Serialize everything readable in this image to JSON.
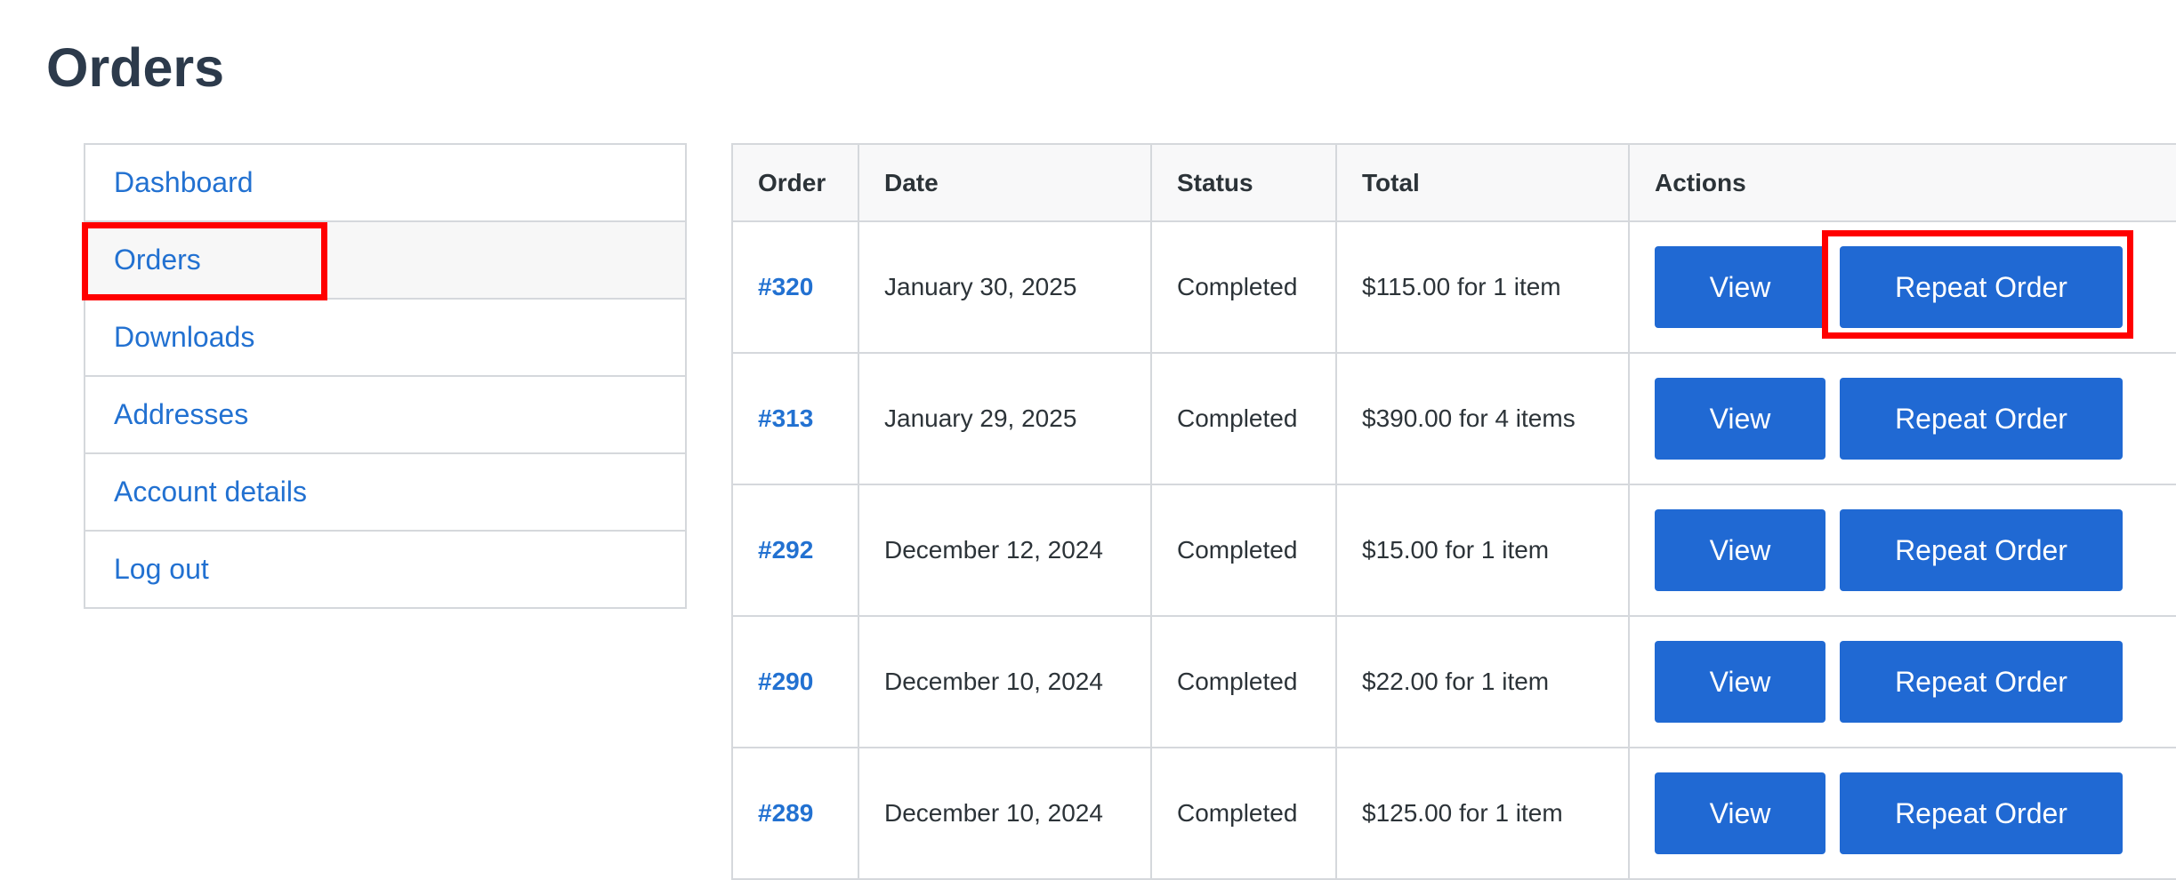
{
  "page": {
    "title": "Orders"
  },
  "nav": {
    "items": [
      {
        "label": "Dashboard"
      },
      {
        "label": "Orders"
      },
      {
        "label": "Downloads"
      },
      {
        "label": "Addresses"
      },
      {
        "label": "Account details"
      },
      {
        "label": "Log out"
      }
    ],
    "active": "Orders"
  },
  "table": {
    "headers": [
      "Order",
      "Date",
      "Status",
      "Total",
      "Actions"
    ],
    "rows": [
      {
        "order": "#320",
        "date": "January 30, 2025",
        "status": "Completed",
        "total": "$115.00 for 1 item",
        "view": "View",
        "repeat": "Repeat Order"
      },
      {
        "order": "#313",
        "date": "January 29, 2025",
        "status": "Completed",
        "total": "$390.00 for 4 items",
        "view": "View",
        "repeat": "Repeat Order"
      },
      {
        "order": "#292",
        "date": "December 12, 2024",
        "status": "Completed",
        "total": "$15.00 for 1 item",
        "view": "View",
        "repeat": "Repeat Order"
      },
      {
        "order": "#290",
        "date": "December 10, 2024",
        "status": "Completed",
        "total": "$22.00 for 1 item",
        "view": "View",
        "repeat": "Repeat Order"
      },
      {
        "order": "#289",
        "date": "December 10, 2024",
        "status": "Completed",
        "total": "$125.00 for 1 item",
        "view": "View",
        "repeat": "Repeat Order"
      }
    ]
  },
  "colors": {
    "link": "#2271d1",
    "button": "#2069d3",
    "highlight": "#ff0000"
  }
}
